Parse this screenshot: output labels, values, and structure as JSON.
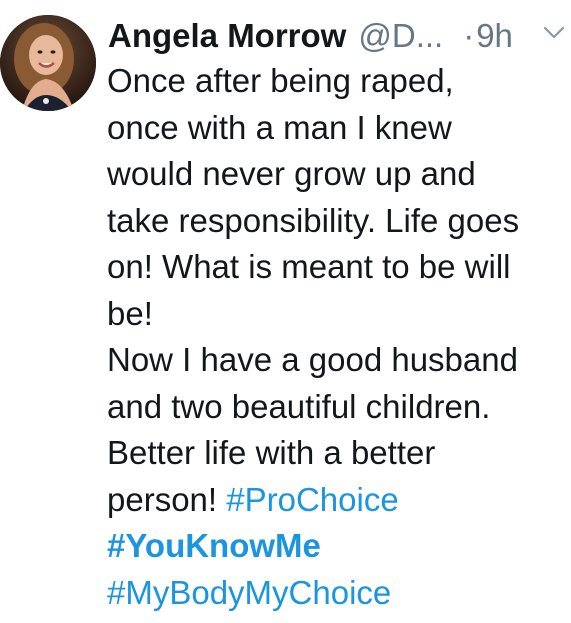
{
  "tweet": {
    "author": {
      "display_name": "Angela Morrow",
      "handle": "@D...",
      "avatar_icon": "avatar-photo"
    },
    "separator": "·",
    "timestamp": "9h",
    "menu_icon": "chevron-down-icon",
    "text_lines": [
      "Once after being raped,",
      "once with a man I knew",
      "would never grow up and",
      "take responsibility. Life goes",
      "on! What is meant to be will",
      "be!",
      "Now I have a good husband",
      "and two beautiful children.",
      "Better life with a better"
    ],
    "last_line_text": "person! ",
    "hashtags": [
      "#ProChoice",
      "#YouKnowMe",
      "#MyBodyMyChoice"
    ],
    "colors": {
      "text": "#14171a",
      "secondary": "#657786",
      "link": "#1b95e0"
    }
  }
}
